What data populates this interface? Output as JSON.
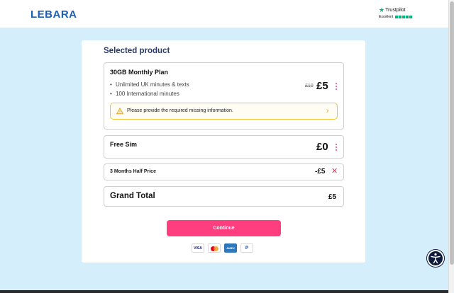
{
  "header": {
    "logo_text": "LEBARA",
    "trustpilot": {
      "brand": "Trustpilot",
      "rating_text": "Excellent"
    }
  },
  "main": {
    "title": "Selected product",
    "plan": {
      "name": "30GB Monthly Plan",
      "features": [
        "Unlimited UK minutes & texts",
        "100 International minutes"
      ],
      "old_price": "£10",
      "price": "£5",
      "warning": "Please provide the required missing information."
    },
    "sim": {
      "name": "Free Sim",
      "price": "£0"
    },
    "discount": {
      "name": "3 Months Half Price",
      "price": "-£5"
    },
    "total": {
      "label": "Grand Total",
      "price": "£5"
    },
    "continue_label": "Continue",
    "payment_methods": [
      "VISA",
      "AMEX",
      "P"
    ]
  },
  "colors": {
    "accent": "#ff3e80",
    "brand": "#1a5fb4",
    "background": "#d4eefb",
    "warning_border": "#f5c23a",
    "trustpilot_green": "#00b67a"
  },
  "icons": {
    "warning": "warning-triangle-icon",
    "accessibility": "accessibility-icon",
    "remove": "close-icon",
    "menu": "kebab-menu-icon"
  }
}
